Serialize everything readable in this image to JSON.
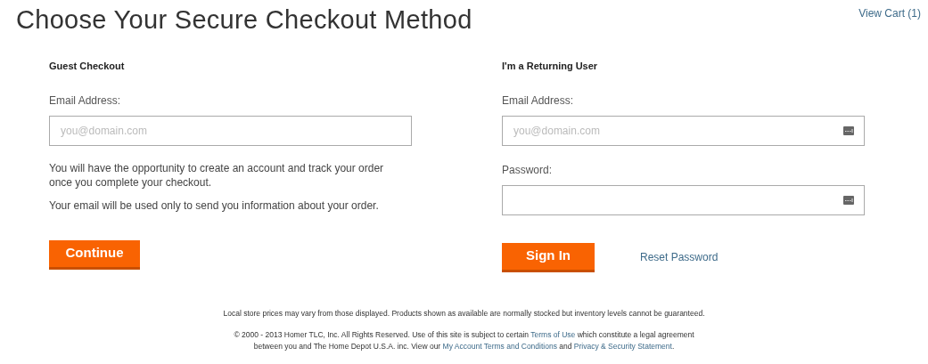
{
  "page_title": "Choose Your Secure Checkout Method",
  "cart_link": "View Cart (1)",
  "guest": {
    "heading": "Guest Checkout",
    "email_label": "Email Address:",
    "email_placeholder": "you@domain.com",
    "notes": [
      "You will have the opportunity to create an account and track your order once you complete your checkout.",
      "Your email will be used only to send you information about your order."
    ],
    "button": "Continue"
  },
  "returning": {
    "heading": "I'm a Returning User",
    "email_label": "Email Address:",
    "email_placeholder": "you@domain.com",
    "password_label": "Password:",
    "button": "Sign In",
    "reset_link": "Reset Password"
  },
  "footer": {
    "disclaimer": "Local store prices may vary from those displayed. Products shown as available are normally stocked but inventory levels cannot be guaranteed.",
    "copyright_lines": [
      [
        {
          "kind": "text",
          "text": "© 2000 - 2013 Homer TLC, Inc. All Rights Reserved. Use of this site is subject to certain "
        },
        {
          "kind": "link",
          "text": "Terms of Use"
        },
        {
          "kind": "text",
          "text": " which constitute a legal agreement"
        }
      ],
      [
        {
          "kind": "text",
          "text": "between you and The Home Depot U.S.A. inc. View our "
        },
        {
          "kind": "link",
          "text": "My Account Terms and Conditions"
        },
        {
          "kind": "text",
          "text": " and "
        },
        {
          "kind": "link",
          "text": "Privacy & Security Statement"
        },
        {
          "kind": "text",
          "text": "."
        }
      ]
    ]
  }
}
